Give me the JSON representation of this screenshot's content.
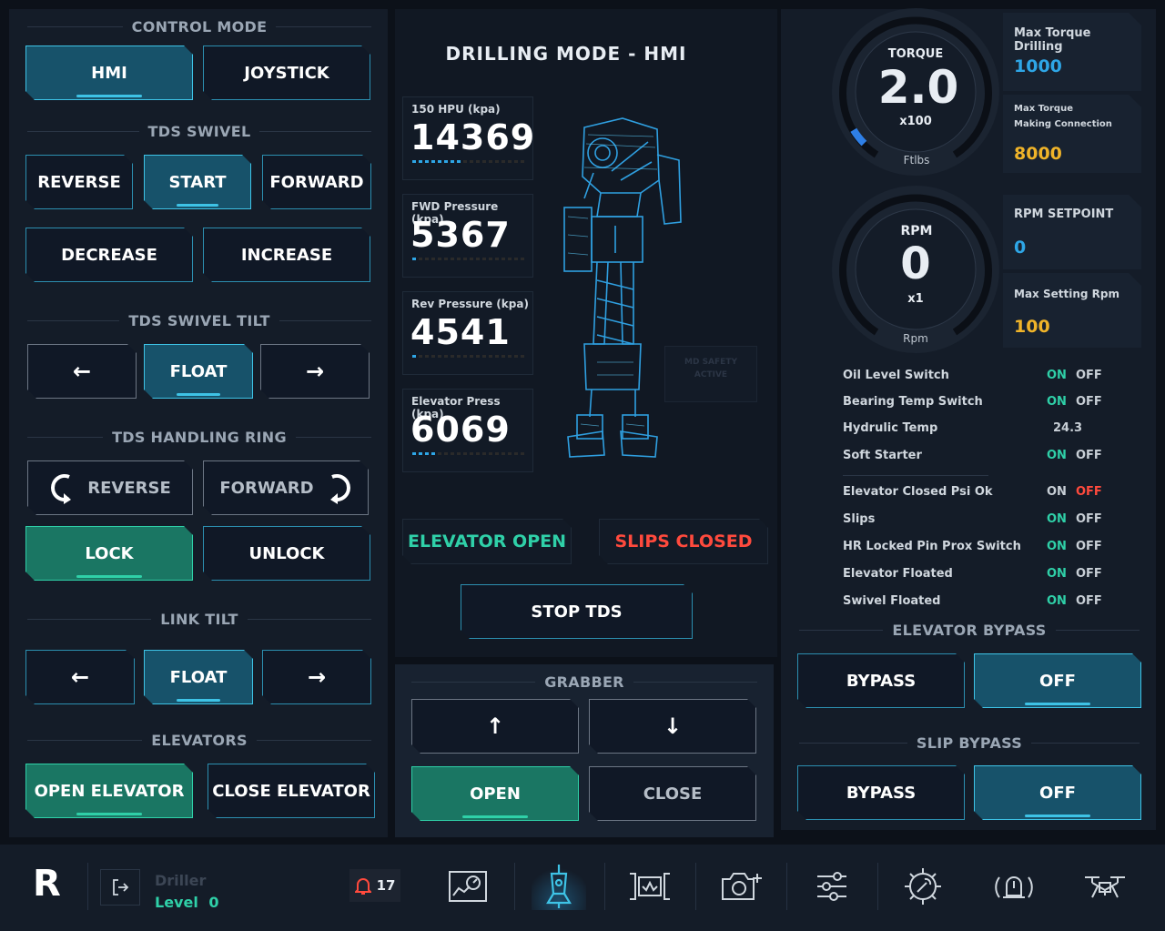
{
  "left": {
    "control_mode": {
      "title": "CONTROL MODE",
      "hmi": "HMI",
      "joystick": "JOYSTICK"
    },
    "tds_swivel": {
      "title": "TDS SWIVEL",
      "reverse": "REVERSE",
      "start": "START",
      "forward": "FORWARD",
      "decrease": "DECREASE",
      "increase": "INCREASE"
    },
    "tds_swivel_tilt": {
      "title": "TDS SWIVEL TILT",
      "left": "←",
      "float": "FLOAT",
      "right": "→"
    },
    "handling_ring": {
      "title": "TDS HANDLING RING",
      "reverse": "REVERSE",
      "forward": "FORWARD",
      "lock": "LOCK",
      "unlock": "UNLOCK"
    },
    "link_tilt": {
      "title": "LINK TILT",
      "left": "←",
      "float": "FLOAT",
      "right": "→"
    },
    "elevators": {
      "title": "ELEVATORS",
      "open": "OPEN ELEVATOR",
      "close": "CLOSE ELEVATOR"
    }
  },
  "center": {
    "title": "DRILLING MODE - HMI",
    "gauges": [
      {
        "label": "150 HPU (kpa)",
        "value": "14369",
        "level": 0.45
      },
      {
        "label": "FWD Pressure (kpa)",
        "value": "5367",
        "level": 0.05
      },
      {
        "label": "Rev Pressure (kpa)",
        "value": "4541",
        "level": 0.05
      },
      {
        "label": "Elevator Press (kpa)",
        "value": "6069",
        "level": 0.2
      }
    ],
    "safety_line1": "MD SAFETY",
    "safety_line2": "ACTIVE",
    "elevator_status": "ELEVATOR OPEN",
    "slips_status": "SLIPS CLOSED",
    "stop_tds": "STOP TDS",
    "grabber": {
      "title": "GRABBER",
      "up": "↑",
      "down": "↓",
      "open": "OPEN",
      "close": "CLOSE"
    }
  },
  "right": {
    "torque": {
      "label": "TORQUE",
      "value": "2.0",
      "mult": "x100",
      "unit": "Ftlbs",
      "level": 0.05
    },
    "rpm": {
      "label": "RPM",
      "value": "0",
      "mult": "x1",
      "unit": "Rpm",
      "level": 0
    },
    "max_torque_drilling": {
      "label": "Max Torque Drilling",
      "value": "1000"
    },
    "max_torque_making": {
      "label1": "Max Torque",
      "label2": "Making Connection",
      "value": "8000"
    },
    "rpm_setpoint": {
      "label": "RPM SETPOINT",
      "value": "0"
    },
    "max_setting_rpm": {
      "label": "Max Setting Rpm",
      "value": "100"
    },
    "io": [
      {
        "name": "Oil Level Switch",
        "on": "ON",
        "off": "OFF",
        "state": "on"
      },
      {
        "name": "Bearing Temp Switch",
        "on": "ON",
        "off": "OFF",
        "state": "on"
      },
      {
        "name": "Hydrulic Temp",
        "value": "24.3"
      },
      {
        "name": "Soft Starter",
        "on": "ON",
        "off": "OFF",
        "state": "on"
      },
      {
        "name": "Elevator Closed Psi Ok",
        "on": "ON",
        "off": "OFF",
        "state": "off"
      },
      {
        "name": "Slips",
        "on": "ON",
        "off": "OFF",
        "state": "on"
      },
      {
        "name": "HR Locked Pin Prox Switch",
        "on": "ON",
        "off": "OFF",
        "state": "on"
      },
      {
        "name": "Elevator Floated",
        "on": "ON",
        "off": "OFF",
        "state": "on"
      },
      {
        "name": "Swivel Floated",
        "on": "ON",
        "off": "OFF",
        "state": "on"
      }
    ],
    "elevator_bypass": {
      "title": "ELEVATOR BYPASS",
      "bypass": "BYPASS",
      "off": "OFF"
    },
    "slip_bypass": {
      "title": "SLIP BYPASS",
      "bypass": "BYPASS",
      "off": "OFF"
    }
  },
  "footer": {
    "logo": "R",
    "user_role": "Driller",
    "level_label": "Level",
    "level_value": "0",
    "alarm_count": "17",
    "icons": [
      "dashboard-icon",
      "drill-icon",
      "pipe-icon",
      "camera-add-icon",
      "sliders-icon",
      "settings-wrench-icon",
      "alarm-icon",
      "drone-icon"
    ]
  },
  "colors": {
    "accent": "#3ec3e6",
    "green": "#2fd0a8",
    "red": "#ff4a3d",
    "gold": "#f0b429",
    "blue": "#2ea6e6"
  }
}
